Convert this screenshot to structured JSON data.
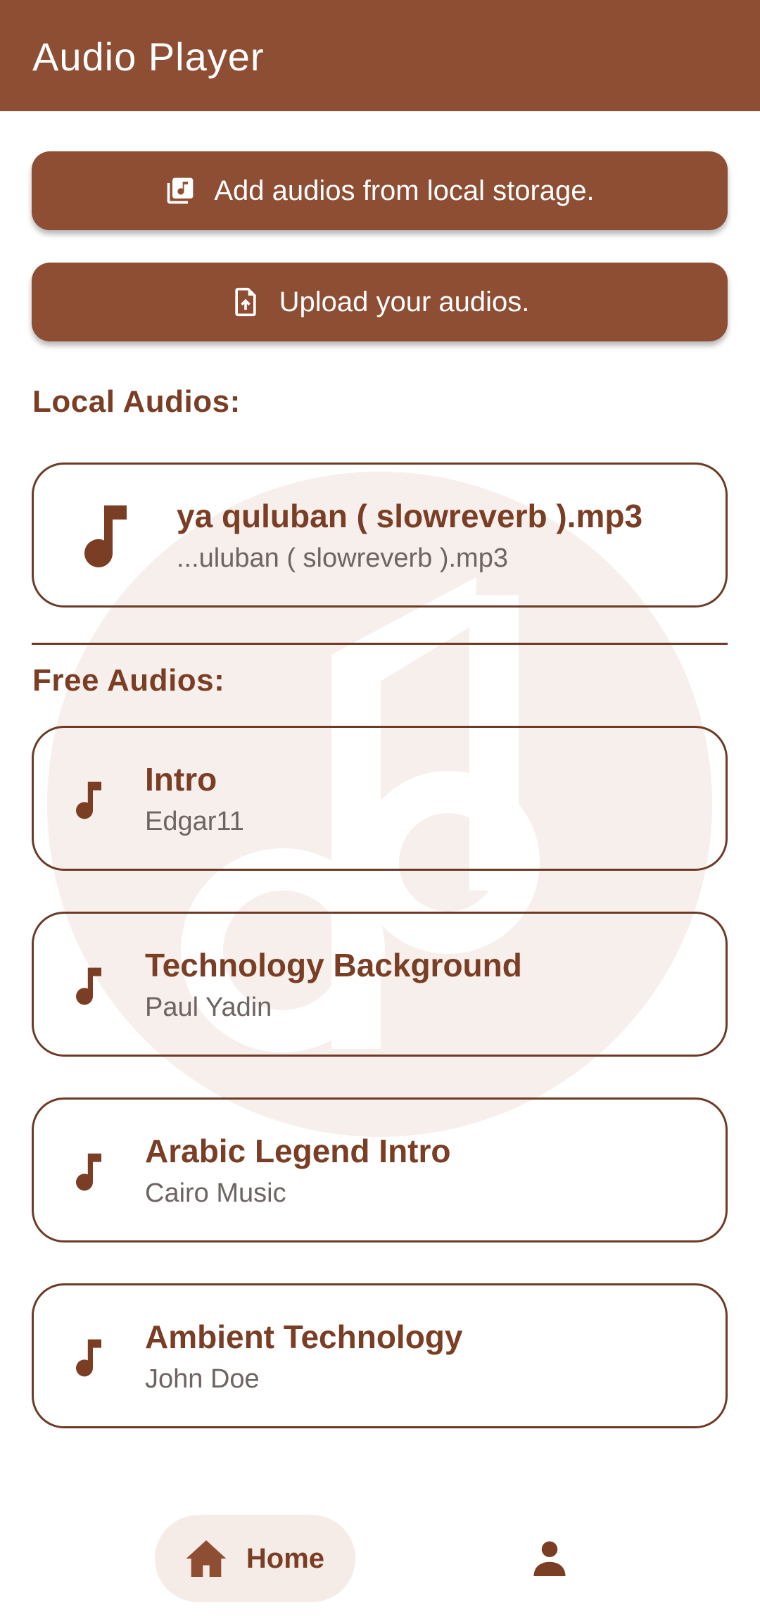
{
  "app": {
    "title": "Audio Player"
  },
  "actions": {
    "add_local_label": "Add audios from local storage.",
    "upload_label": "Upload your audios."
  },
  "sections": {
    "local_title": "Local Audios:",
    "free_title": "Free Audios:"
  },
  "local_audios": [
    {
      "title": "ya quluban ( slowreverb ).mp3",
      "subtitle": "...uluban ( slowreverb ).mp3"
    }
  ],
  "free_audios": [
    {
      "title": "Intro",
      "artist": "Edgar11"
    },
    {
      "title": "Technology Background",
      "artist": "Paul Yadin"
    },
    {
      "title": "Arabic Legend Intro",
      "artist": "Cairo Music"
    },
    {
      "title": "Ambient Technology",
      "artist": "John Doe"
    }
  ],
  "bottom_nav": {
    "home_label": "Home",
    "home_icon": "home-icon",
    "profile_icon": "person-icon"
  },
  "colors": {
    "primary": "#8d4e33",
    "primary_dark": "#7a3e25",
    "outline": "#6d3a26",
    "watermark": "#f7efec",
    "nav_pill": "#f5ebe7"
  }
}
